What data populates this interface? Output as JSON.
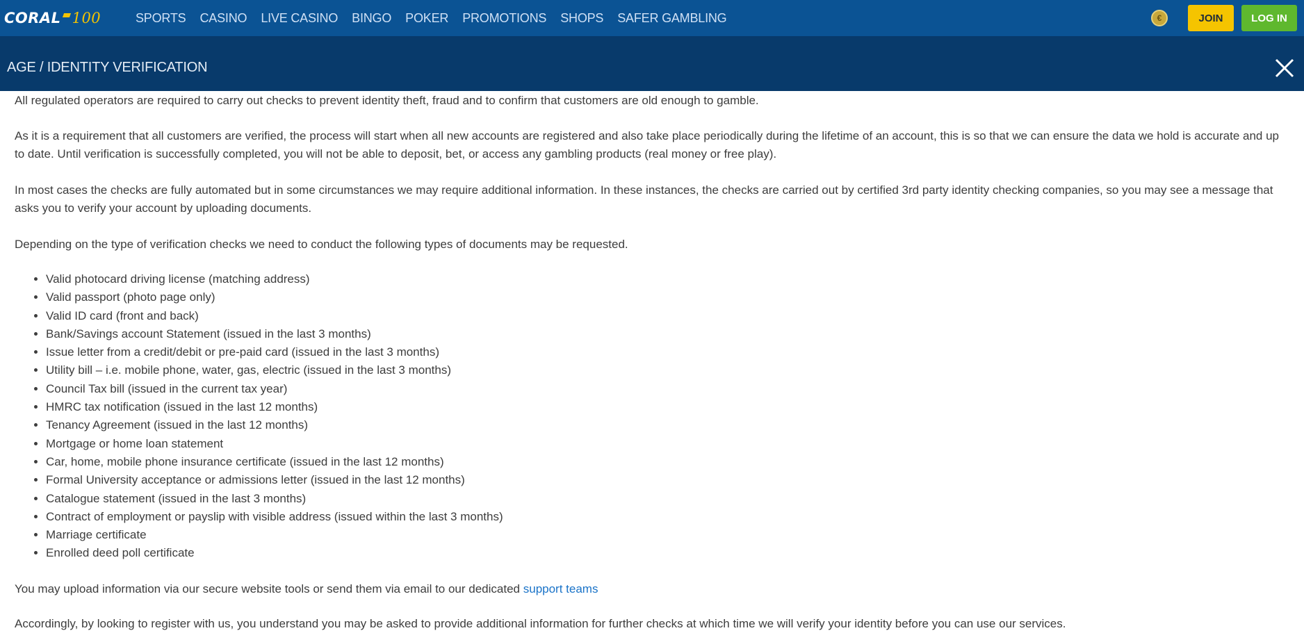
{
  "header": {
    "logo_text": "CORAL",
    "logo_suffix": "100",
    "nav": [
      "SPORTS",
      "CASINO",
      "LIVE CASINO",
      "BINGO",
      "POKER",
      "PROMOTIONS",
      "SHOPS",
      "SAFER GAMBLING"
    ],
    "coin_icon": "€",
    "join_label": "JOIN",
    "login_label": "LOG IN"
  },
  "modal": {
    "title": "AGE / IDENTITY VERIFICATION",
    "close_icon": "close-icon"
  },
  "content": {
    "p1": "All regulated operators are required to carry out checks to prevent identity theft, fraud and to confirm that customers are old enough to gamble.",
    "p2": "As it is a requirement that all customers are verified, the process will start when all new accounts are registered and also take place periodically during the lifetime of an account, this is so that we can ensure the data we hold is accurate and up to date. Until verification is successfully completed, you will not be able to deposit, bet, or access any gambling products (real money or free play).",
    "p3": "In most cases the checks are fully automated but in some circumstances we may require additional information. In these instances, the checks are carried out by certified 3rd party identity checking companies, so you may see a message that asks you to verify your account by uploading documents.",
    "p4": "Depending on the type of verification checks we need to conduct the following types of documents may be requested.",
    "documents": [
      "Valid photocard driving license (matching address)",
      "Valid passport (photo page only)",
      "Valid ID card (front and back)",
      "Bank/Savings account Statement (issued in the last 3 months)",
      "Issue letter from a credit/debit or pre-paid card (issued in the last 3 months)",
      "Utility bill – i.e. mobile phone, water, gas, electric (issued in the last 3 months)",
      "Council Tax bill (issued in the current tax year)",
      "HMRC tax notification (issued in the last 12 months)",
      "Tenancy Agreement (issued in the last 12 months)",
      "Mortgage or home loan statement",
      "Car, home, mobile phone insurance certificate (issued in the last 12 months)",
      "Formal University acceptance or admissions letter (issued in the last 12 months)",
      "Catalogue statement (issued in the last 3 months)",
      "Contract of employment or payslip with visible address (issued within the last 3 months)",
      "Marriage certificate",
      "Enrolled deed poll certificate"
    ],
    "p5_text": "You may upload information via our secure website tools or send them via email to our dedicated ",
    "p5_link": "support teams",
    "p6_partial": "Accordingly, by looking to register with us, you understand you may be asked to provide additional information for further checks at which time we will verify your identity before you can use our services."
  },
  "colors": {
    "nav_bg": "#0b5394",
    "modal_header_bg": "#083a6b",
    "join": "#f5c400",
    "login": "#5fb82e",
    "link": "#1a73c8"
  }
}
